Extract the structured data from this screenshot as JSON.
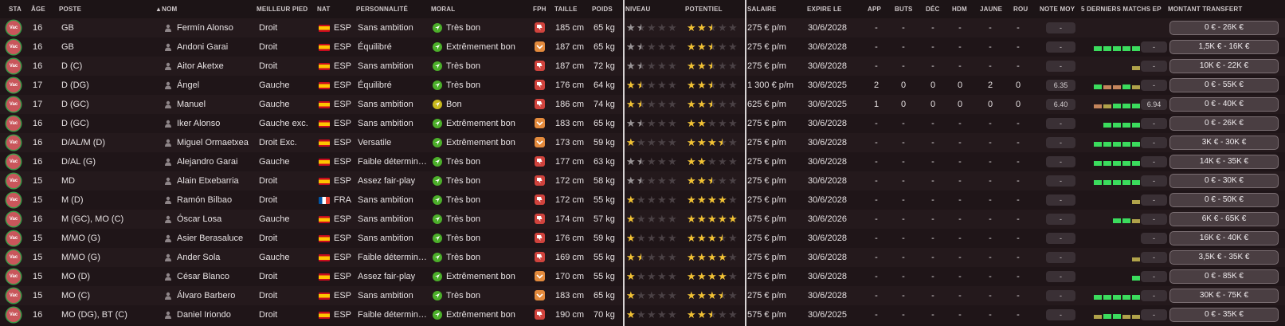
{
  "columns": {
    "sta": "STA",
    "age": "ÂGE",
    "poste": "POSTE",
    "nom": "NOM",
    "pied": "MEILLEUR PIED",
    "nat": "NAT",
    "pers": "PERSONNALITÉ",
    "moral": "MORAL",
    "fph": "FPH",
    "taille": "TAILLE",
    "poids": "POIDS",
    "niveau": "NIVEAU",
    "potentiel": "POTENTIEL",
    "salaire": "SALAIRE",
    "expire": "EXPIRE LE",
    "app": "APP",
    "buts": "BUTS",
    "dec": "DÉC",
    "hdm": "HDM",
    "jaune": "JAUNE",
    "rou": "ROU",
    "note": "NOTE MOY",
    "last5": "5 DERNIERS MATCHS EP",
    "montant": "MONTANT TRANSFERT",
    "sort_icon": "triangle-up-icon"
  },
  "status_label": "Vac",
  "colors": {
    "status_red": "#c9565b",
    "status_ring": "#3a9b48",
    "mood_green": "#4caf2a",
    "mood_yellow": "#c8b81c",
    "fph_red": "#d0433d",
    "fph_orange": "#e38a3c",
    "star_gold": "#f2c233",
    "star_gray": "#9a9597",
    "form_green": "#3bdc5d",
    "form_olive": "#b0a24a",
    "form_orange": "#c4855c"
  },
  "players": [
    {
      "age": "16",
      "pos": "GB",
      "name": "Fermín Alonso",
      "foot": "Droit",
      "nat": "ESP",
      "flag": "esp",
      "pers": "Sans ambition",
      "mood": "Très bon",
      "mood_color": "green",
      "fph": "red",
      "height": "185 cm",
      "weight": "65 kg",
      "ability": 1.5,
      "ability_color": "gray",
      "potential": 2.5,
      "potential_color": "gold",
      "salary": "275 € p/m",
      "expires": "30/6/2028",
      "app": "-",
      "goals": "-",
      "dec": "-",
      "hdm": "-",
      "yellow": "-",
      "red": "-",
      "avg": "-",
      "form": [],
      "form_rating": "",
      "fee": "0 € - 26K €"
    },
    {
      "age": "16",
      "pos": "GB",
      "name": "Andoni Garai",
      "foot": "Droit",
      "nat": "ESP",
      "flag": "esp",
      "pers": "Équilibré",
      "mood": "Extrêmement bon",
      "mood_color": "green",
      "fph": "orange",
      "height": "187 cm",
      "weight": "65 kg",
      "ability": 1.5,
      "ability_color": "gray",
      "potential": 2.5,
      "potential_color": "gold",
      "salary": "275 € p/m",
      "expires": "30/6/2028",
      "app": "-",
      "goals": "-",
      "dec": "-",
      "hdm": "-",
      "yellow": "-",
      "red": "-",
      "avg": "-",
      "form": [
        "g",
        "g",
        "g",
        "g",
        "g"
      ],
      "form_rating": "-",
      "fee": "1,5K € - 16K €"
    },
    {
      "age": "16",
      "pos": "D (C)",
      "name": "Aitor Aketxe",
      "foot": "Droit",
      "nat": "ESP",
      "flag": "esp",
      "pers": "Sans ambition",
      "mood": "Très bon",
      "mood_color": "green",
      "fph": "red",
      "height": "187 cm",
      "weight": "72 kg",
      "ability": 1.5,
      "ability_color": "gray",
      "potential": 2.5,
      "potential_color": "gold",
      "salary": "275 € p/m",
      "expires": "30/6/2028",
      "app": "-",
      "goals": "-",
      "dec": "-",
      "hdm": "-",
      "yellow": "-",
      "red": "-",
      "avg": "-",
      "form": [
        "",
        "",
        "",
        "",
        "o"
      ],
      "form_rating": "-",
      "fee": "10K € - 22K €"
    },
    {
      "age": "17",
      "pos": "D (DG)",
      "name": "Ángel",
      "foot": "Gauche",
      "nat": "ESP",
      "flag": "esp",
      "pers": "Équilibré",
      "mood": "Très bon",
      "mood_color": "green",
      "fph": "red",
      "height": "176 cm",
      "weight": "64 kg",
      "ability": 1.5,
      "ability_color": "gold",
      "potential": 2.5,
      "potential_color": "gold",
      "salary": "1 300 € p/m",
      "expires": "30/6/2025",
      "app": "2",
      "goals": "0",
      "dec": "0",
      "hdm": "0",
      "yellow": "2",
      "red": "0",
      "avg": "6.35",
      "form": [
        "g",
        "r",
        "r",
        "g",
        "o"
      ],
      "form_rating": "-",
      "fee": "0 € - 55K €"
    },
    {
      "age": "17",
      "pos": "D (GC)",
      "name": "Manuel",
      "foot": "Gauche",
      "nat": "ESP",
      "flag": "esp",
      "pers": "Sans ambition",
      "mood": "Bon",
      "mood_color": "yellow",
      "fph": "red",
      "height": "186 cm",
      "weight": "74 kg",
      "ability": 1.5,
      "ability_color": "gold",
      "potential": 2.5,
      "potential_color": "gold",
      "salary": "625 € p/m",
      "expires": "30/6/2025",
      "app": "1",
      "goals": "0",
      "dec": "0",
      "hdm": "0",
      "yellow": "0",
      "red": "0",
      "avg": "6.40",
      "form": [
        "r",
        "o",
        "g",
        "g",
        "g"
      ],
      "form_rating": "6.94",
      "fee": "0 € - 40K €"
    },
    {
      "age": "16",
      "pos": "D (GC)",
      "name": "Iker Alonso",
      "foot": "Gauche exc.",
      "nat": "ESP",
      "flag": "esp",
      "pers": "Sans ambition",
      "mood": "Extrêmement bon",
      "mood_color": "green",
      "fph": "orange",
      "height": "183 cm",
      "weight": "65 kg",
      "ability": 1.5,
      "ability_color": "gray",
      "potential": 2,
      "potential_color": "gold",
      "salary": "275 € p/m",
      "expires": "30/6/2028",
      "app": "-",
      "goals": "-",
      "dec": "-",
      "hdm": "-",
      "yellow": "-",
      "red": "-",
      "avg": "-",
      "form": [
        "",
        "g",
        "g",
        "g",
        "g"
      ],
      "form_rating": "-",
      "fee": "0 € - 26K €"
    },
    {
      "age": "16",
      "pos": "D/AL/M (D)",
      "name": "Miguel Ormaetxea",
      "foot": "Droit Exc.",
      "nat": "ESP",
      "flag": "esp",
      "pers": "Versatile",
      "mood": "Extrêmement bon",
      "mood_color": "green",
      "fph": "orange",
      "height": "173 cm",
      "weight": "59 kg",
      "ability": 1,
      "ability_color": "gold",
      "potential": 3.5,
      "potential_color": "gold",
      "salary": "275 € p/m",
      "expires": "30/6/2028",
      "app": "-",
      "goals": "-",
      "dec": "-",
      "hdm": "-",
      "yellow": "-",
      "red": "-",
      "avg": "-",
      "form": [
        "g",
        "g",
        "g",
        "g",
        "g"
      ],
      "form_rating": "-",
      "fee": "3K € - 30K €"
    },
    {
      "age": "16",
      "pos": "D/AL (G)",
      "name": "Alejandro Garai",
      "foot": "Gauche",
      "nat": "ESP",
      "flag": "esp",
      "pers": "Faible détermin…",
      "mood": "Très bon",
      "mood_color": "green",
      "fph": "red",
      "height": "177 cm",
      "weight": "63 kg",
      "ability": 1.5,
      "ability_color": "gray",
      "potential": 2,
      "potential_color": "gold",
      "salary": "275 € p/m",
      "expires": "30/6/2028",
      "app": "-",
      "goals": "-",
      "dec": "-",
      "hdm": "-",
      "yellow": "-",
      "red": "-",
      "avg": "-",
      "form": [
        "g",
        "g",
        "g",
        "g",
        "g"
      ],
      "form_rating": "-",
      "fee": "14K € - 35K €"
    },
    {
      "age": "15",
      "pos": "MD",
      "name": "Alain Etxebarria",
      "foot": "Droit",
      "nat": "ESP",
      "flag": "esp",
      "pers": "Assez fair-play",
      "mood": "Très bon",
      "mood_color": "green",
      "fph": "red",
      "height": "172 cm",
      "weight": "58 kg",
      "ability": 1.5,
      "ability_color": "gray",
      "potential": 2.5,
      "potential_color": "gold",
      "salary": "275 € p/m",
      "expires": "30/6/2028",
      "app": "-",
      "goals": "-",
      "dec": "-",
      "hdm": "-",
      "yellow": "-",
      "red": "-",
      "avg": "-",
      "form": [
        "g",
        "g",
        "g",
        "g",
        "g"
      ],
      "form_rating": "-",
      "fee": "0 € - 30K €"
    },
    {
      "age": "15",
      "pos": "M (D)",
      "name": "Ramón Bilbao",
      "foot": "Droit",
      "nat": "FRA",
      "flag": "fra",
      "pers": "Sans ambition",
      "mood": "Très bon",
      "mood_color": "green",
      "fph": "red",
      "height": "172 cm",
      "weight": "55 kg",
      "ability": 1,
      "ability_color": "gold",
      "potential": 4,
      "potential_color": "gold",
      "salary": "275 € p/m",
      "expires": "30/6/2028",
      "app": "-",
      "goals": "-",
      "dec": "-",
      "hdm": "-",
      "yellow": "-",
      "red": "-",
      "avg": "-",
      "form": [
        "",
        "",
        "",
        "",
        "o"
      ],
      "form_rating": "-",
      "fee": "0 € - 50K €"
    },
    {
      "age": "16",
      "pos": "M (GC), MO (C)",
      "name": "Óscar Losa",
      "foot": "Gauche",
      "nat": "ESP",
      "flag": "esp",
      "pers": "Sans ambition",
      "mood": "Très bon",
      "mood_color": "green",
      "fph": "red",
      "height": "174 cm",
      "weight": "57 kg",
      "ability": 1,
      "ability_color": "gold",
      "potential": 5,
      "potential_color": "gold",
      "salary": "675 € p/m",
      "expires": "30/6/2026",
      "app": "-",
      "goals": "-",
      "dec": "-",
      "hdm": "-",
      "yellow": "-",
      "red": "-",
      "avg": "-",
      "form": [
        "",
        "",
        "g",
        "g",
        "o"
      ],
      "form_rating": "-",
      "fee": "6K € - 65K €"
    },
    {
      "age": "15",
      "pos": "M/MO (G)",
      "name": "Asier Berasaluce",
      "foot": "Droit",
      "nat": "ESP",
      "flag": "esp",
      "pers": "Sans ambition",
      "mood": "Très bon",
      "mood_color": "green",
      "fph": "red",
      "height": "176 cm",
      "weight": "59 kg",
      "ability": 1,
      "ability_color": "gold",
      "potential": 3.5,
      "potential_color": "gold",
      "salary": "275 € p/m",
      "expires": "30/6/2028",
      "app": "-",
      "goals": "-",
      "dec": "-",
      "hdm": "-",
      "yellow": "-",
      "red": "-",
      "avg": "-",
      "form": [],
      "form_rating": "-",
      "fee": "16K € - 40K €"
    },
    {
      "age": "15",
      "pos": "M/MO (G)",
      "name": "Ander Sola",
      "foot": "Gauche",
      "nat": "ESP",
      "flag": "esp",
      "pers": "Faible détermin…",
      "mood": "Très bon",
      "mood_color": "green",
      "fph": "red",
      "height": "169 cm",
      "weight": "55 kg",
      "ability": 1.5,
      "ability_color": "gold",
      "potential": 4,
      "potential_color": "gold",
      "salary": "275 € p/m",
      "expires": "30/6/2028",
      "app": "-",
      "goals": "-",
      "dec": "-",
      "hdm": "-",
      "yellow": "-",
      "red": "-",
      "avg": "-",
      "form": [
        "",
        "",
        "",
        "",
        "o"
      ],
      "form_rating": "-",
      "fee": "3,5K € - 35K €"
    },
    {
      "age": "15",
      "pos": "MO (D)",
      "name": "César Blanco",
      "foot": "Droit",
      "nat": "ESP",
      "flag": "esp",
      "pers": "Assez fair-play",
      "mood": "Extrêmement bon",
      "mood_color": "green",
      "fph": "orange",
      "height": "170 cm",
      "weight": "55 kg",
      "ability": 1,
      "ability_color": "gold",
      "potential": 4,
      "potential_color": "gold",
      "salary": "275 € p/m",
      "expires": "30/6/2028",
      "app": "-",
      "goals": "-",
      "dec": "-",
      "hdm": "-",
      "yellow": "-",
      "red": "-",
      "avg": "-",
      "form": [
        "",
        "",
        "",
        "",
        "g"
      ],
      "form_rating": "-",
      "fee": "0 € - 85K €"
    },
    {
      "age": "15",
      "pos": "MO (C)",
      "name": "Álvaro Barbero",
      "foot": "Droit",
      "nat": "ESP",
      "flag": "esp",
      "pers": "Sans ambition",
      "mood": "Très bon",
      "mood_color": "green",
      "fph": "orange",
      "height": "183 cm",
      "weight": "65 kg",
      "ability": 1,
      "ability_color": "gold",
      "potential": 3.5,
      "potential_color": "gold",
      "salary": "275 € p/m",
      "expires": "30/6/2028",
      "app": "-",
      "goals": "-",
      "dec": "-",
      "hdm": "-",
      "yellow": "-",
      "red": "-",
      "avg": "-",
      "form": [
        "g",
        "g",
        "g",
        "g",
        "g"
      ],
      "form_rating": "-",
      "fee": "30K € - 75K €"
    },
    {
      "age": "16",
      "pos": "MO (DG), BT (C)",
      "name": "Daniel Iriondo",
      "foot": "Droit",
      "nat": "ESP",
      "flag": "esp",
      "pers": "Faible détermin…",
      "mood": "Extrêmement bon",
      "mood_color": "green",
      "fph": "red",
      "height": "190 cm",
      "weight": "70 kg",
      "ability": 1,
      "ability_color": "gold",
      "potential": 2.5,
      "potential_color": "gold",
      "salary": "575 € p/m",
      "expires": "30/6/2025",
      "app": "-",
      "goals": "-",
      "dec": "-",
      "hdm": "-",
      "yellow": "-",
      "red": "-",
      "avg": "-",
      "form": [
        "o",
        "g",
        "g",
        "o",
        "o"
      ],
      "form_rating": "-",
      "fee": "0 € - 35K €"
    }
  ]
}
